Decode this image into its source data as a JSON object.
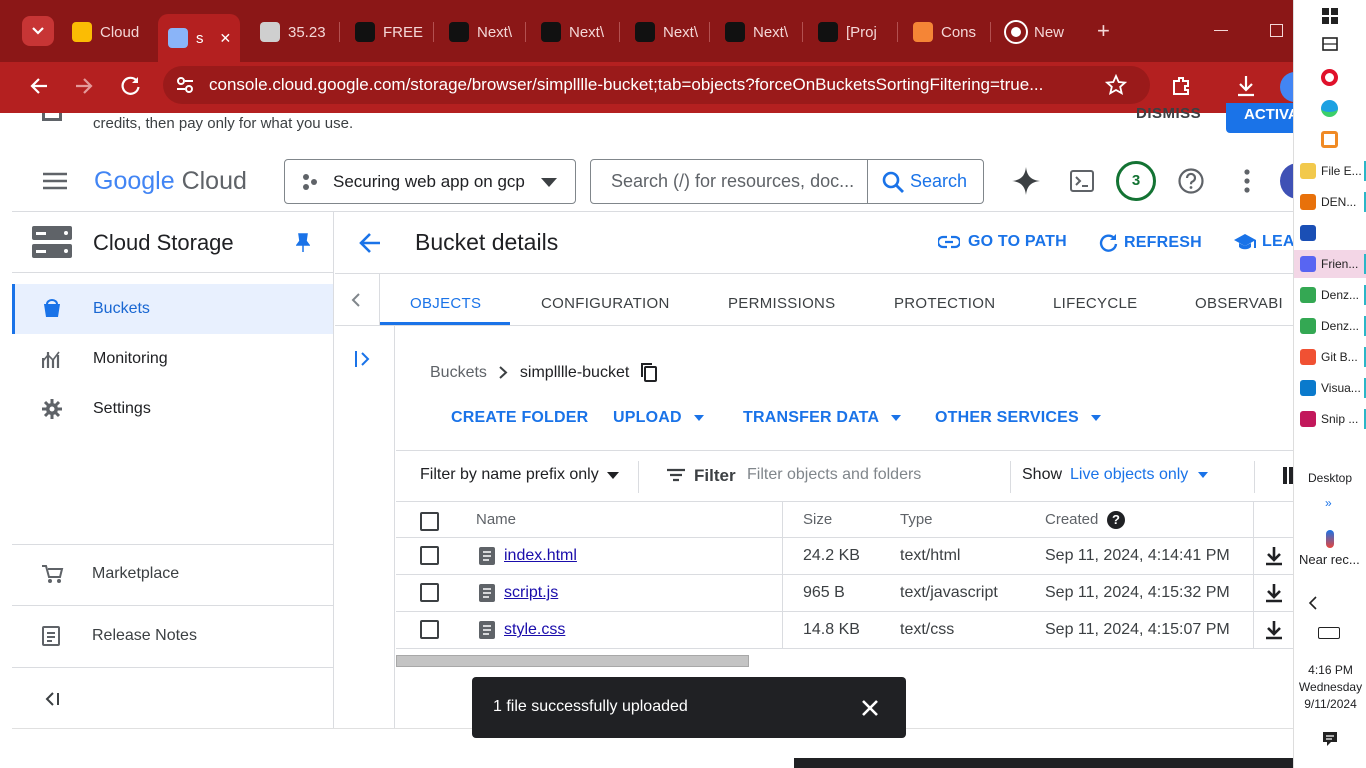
{
  "browser": {
    "tabs": [
      {
        "label": "Cloud",
        "icon": "google-cloud-icon"
      },
      {
        "label": "s",
        "icon": "storage-icon",
        "active": true
      },
      {
        "label": "35.23",
        "icon": "globe-icon"
      },
      {
        "label": "FREE",
        "icon": "notion-icon"
      },
      {
        "label": "Next\\",
        "icon": "notion-icon"
      },
      {
        "label": "Next\\",
        "icon": "notion-icon"
      },
      {
        "label": "Next\\",
        "icon": "notion-icon"
      },
      {
        "label": "Next\\",
        "icon": "notion-icon"
      },
      {
        "label": "[Proj",
        "icon": "notion-icon"
      },
      {
        "label": "Cons",
        "icon": "aws-icon"
      },
      {
        "label": "New",
        "icon": "chrome-icon"
      }
    ],
    "url": "console.cloud.google.com/storage/browser/simplllle-bucket;tab=objects?forceOnBucketsSortingFiltering=true..."
  },
  "banner": {
    "text": "credits, then pay only for what you use.",
    "dismiss": "DISMISS",
    "activate": "ACTIVA"
  },
  "header": {
    "brand_google": "Google",
    "brand_cloud": "Cloud",
    "project": "Securing web app on gcp",
    "search_placeholder": "Search (/) for resources, doc...",
    "search_button": "Search",
    "notifications": "3"
  },
  "sidebar": {
    "title": "Cloud Storage",
    "items": [
      {
        "label": "Buckets",
        "active": true
      },
      {
        "label": "Monitoring"
      },
      {
        "label": "Settings"
      }
    ],
    "footer": [
      {
        "label": "Marketplace"
      },
      {
        "label": "Release Notes"
      }
    ]
  },
  "main": {
    "title": "Bucket details",
    "go_to_path": "GO TO PATH",
    "refresh": "REFRESH",
    "learn": "LEA",
    "tabs": [
      "OBJECTS",
      "CONFIGURATION",
      "PERMISSIONS",
      "PROTECTION",
      "LIFECYCLE",
      "OBSERVABI"
    ],
    "breadcrumb": {
      "root": "Buckets",
      "bucket": "simplllle-bucket"
    },
    "actions": [
      "CREATE FOLDER",
      "UPLOAD",
      "TRANSFER DATA",
      "OTHER SERVICES"
    ],
    "filter_mode": "Filter by name prefix only",
    "filter_label": "Filter",
    "filter_placeholder": "Filter objects and folders",
    "show_label": "Show",
    "show_value": "Live objects only",
    "columns": [
      "Name",
      "Size",
      "Type",
      "Created"
    ],
    "rows": [
      {
        "name": "index.html",
        "size": "24.2 KB",
        "type": "text/html",
        "created": "Sep 11, 2024, 4:14:41 PM"
      },
      {
        "name": "script.js",
        "size": "965 B",
        "type": "text/javascript",
        "created": "Sep 11, 2024, 4:15:32 PM"
      },
      {
        "name": "style.css",
        "size": "14.8 KB",
        "type": "text/css",
        "created": "Sep 11, 2024, 4:15:07 PM"
      }
    ]
  },
  "toast": {
    "message": "1 file successfully uploaded"
  },
  "taskbar": {
    "items": [
      {
        "label": "File E...",
        "color": "#f2c94c"
      },
      {
        "label": "DEN...",
        "color": "#e8710a"
      },
      {
        "label": "",
        "color": "#1a4fb5"
      },
      {
        "label": "Frien...",
        "color": "#5865f2"
      },
      {
        "label": "Denz...",
        "color": "#34a853"
      },
      {
        "label": "Denz...",
        "color": "#34a853"
      },
      {
        "label": "Git B...",
        "color": "#f05133"
      },
      {
        "label": "Visua...",
        "color": "#0a7acc"
      },
      {
        "label": "Snip ...",
        "color": "#c2185b"
      }
    ],
    "desktop": "Desktop",
    "weather": "Near rec...",
    "time": "4:16 PM",
    "day": "Wednesday",
    "date": "9/11/2024"
  }
}
